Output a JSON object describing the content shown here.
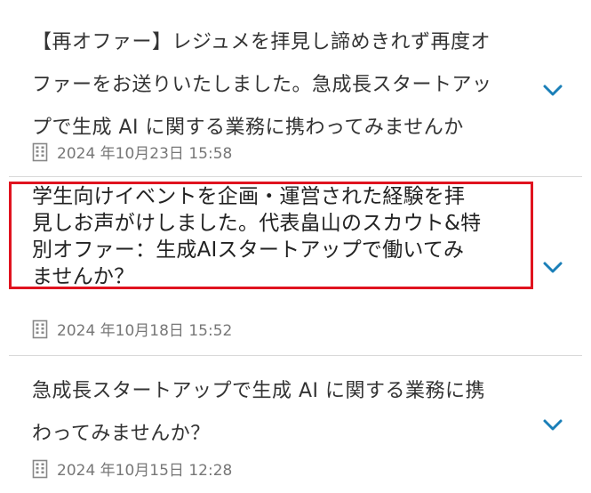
{
  "messages": [
    {
      "title": "【再オファー】レジュメを拝見し諦めきれず再度オ\nファーをお送りいたしました。急成長スタートアッ\nプで生成 AI に関する業務に携わってみませんか",
      "date": "2024 年10月23日 15:58",
      "company_icon": "building-icon",
      "expand_icon": "chevron-down-icon"
    },
    {
      "title": "学生向けイベントを企画・運営された経験を拝\n見しお声がけしました。代表畠山のスカウト&特\n別オファー：生成AIスタートアップで働いてみ\nませんか？",
      "date": "2024 年10月18日 15:52",
      "company_icon": "building-icon",
      "expand_icon": "chevron-down-icon"
    },
    {
      "title": "急成長スタートアップで生成 AI に関する業務に携\nわってみませんか？",
      "date": "2024 年10月15日 12:28",
      "company_icon": "building-icon",
      "expand_icon": "chevron-down-icon"
    }
  ],
  "colors": {
    "highlight": "#e0131f",
    "chevron": "#1a7fb8",
    "text": "#333333",
    "meta": "#777777",
    "divider": "#d9d9d9"
  }
}
